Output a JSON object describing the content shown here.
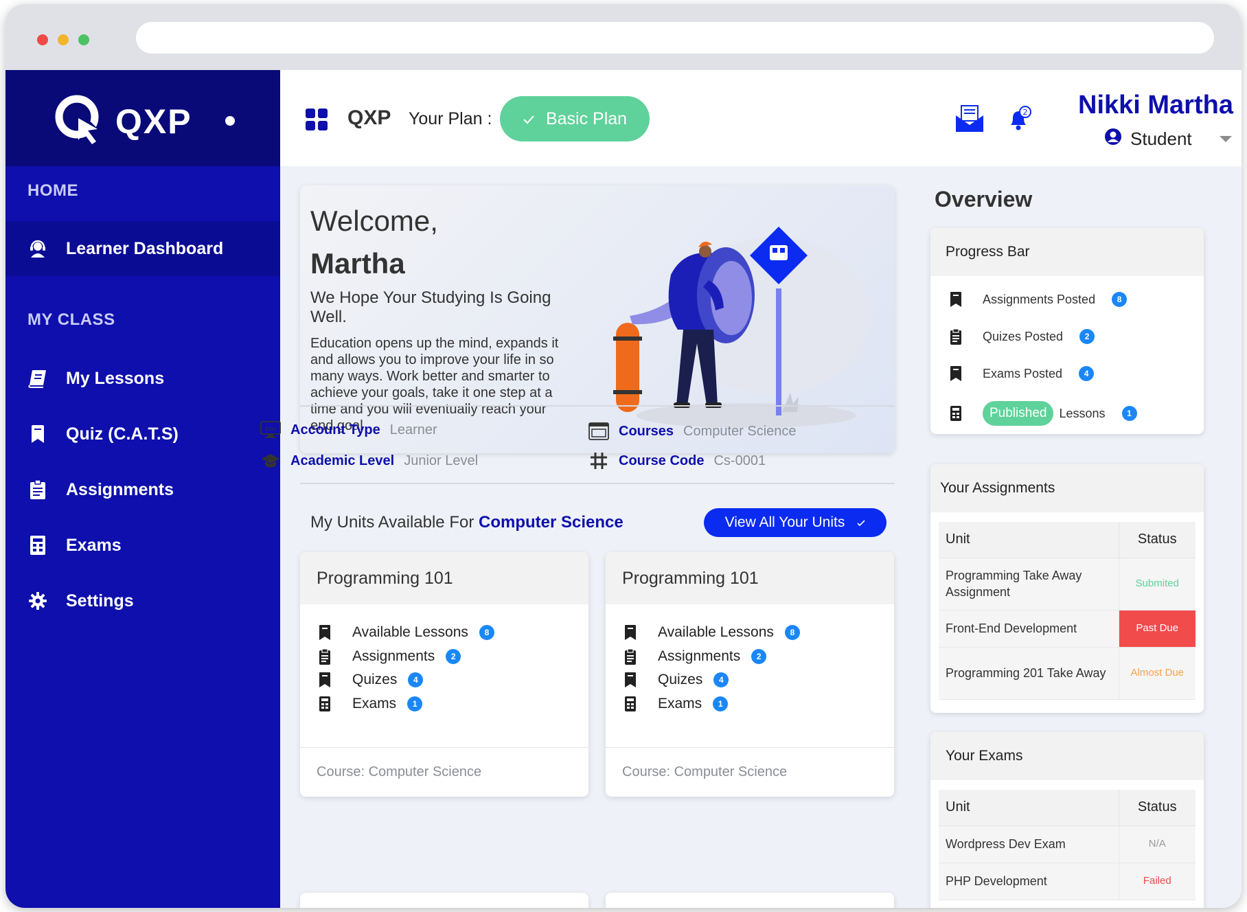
{
  "colors": {
    "sidebar": "#0e0fac",
    "sidebar_logo_bg": "#090a78",
    "accent_blue": "#0b2bf0",
    "plan_green": "#5ed29a",
    "badge_blue": "#1b87f7",
    "past_due_red": "#f24b4b",
    "almost_due_orange": "#f7a34b"
  },
  "sidebar": {
    "logo_text": "QXP",
    "section_home": "HOME",
    "section_class": "MY CLASS",
    "items": [
      {
        "label": "Learner Dashboard",
        "icon": "headset-user-icon"
      },
      {
        "label": "My Lessons",
        "icon": "book-icon"
      },
      {
        "label": "Quiz (C.A.T.S)",
        "icon": "bookmark-icon"
      },
      {
        "label": "Assignments",
        "icon": "clipboard-icon"
      },
      {
        "label": "Exams",
        "icon": "calculator-icon"
      },
      {
        "label": "Settings",
        "icon": "gear-icon"
      }
    ]
  },
  "header": {
    "brand": "QXP",
    "plan_label": "Your Plan :",
    "plan_button": "Basic Plan",
    "user_name": "Nikki Martha",
    "user_role": "Student",
    "notifications_count": "2"
  },
  "welcome": {
    "title": "Welcome,",
    "name": "Martha",
    "subtitle": "We Hope Your Studying Is Going Well.",
    "body": "Education opens up the mind, expands it and allows you to improve your life in so many ways. Work better and smarter to achieve your goals, take it one step at a time and you will eventually reach your end goal"
  },
  "account": {
    "account_type_label": "Account Type",
    "account_type_value": "Learner",
    "academic_level_label": "Academic Level",
    "academic_level_value": "Junior Level",
    "courses_label": "Courses",
    "courses_value": "Computer Science",
    "course_code_label": "Course Code",
    "course_code_value": "Cs-0001"
  },
  "units": {
    "title_prefix": "My Units Available For",
    "title_course": "Computer Science",
    "view_all_button": "View All Your Units",
    "cards": [
      {
        "title": "Programming 101",
        "rows": [
          {
            "label": "Available Lessons",
            "count": "8"
          },
          {
            "label": "Assignments",
            "count": "2"
          },
          {
            "label": "Quizes",
            "count": "4"
          },
          {
            "label": "Exams",
            "count": "1"
          }
        ],
        "footer": "Course: Computer Science"
      },
      {
        "title": "Programming 101",
        "rows": [
          {
            "label": "Available Lessons",
            "count": "8"
          },
          {
            "label": "Assignments",
            "count": "2"
          },
          {
            "label": "Quizes",
            "count": "4"
          },
          {
            "label": "Exams",
            "count": "1"
          }
        ],
        "footer": "Course: Computer Science"
      }
    ]
  },
  "overview": {
    "title": "Overview",
    "progress": {
      "title": "Progress Bar",
      "assignments_label": "Assignments Posted",
      "assignments_count": "8",
      "quizes_label": "Quizes Posted",
      "quizes_count": "2",
      "exams_label": "Exams Posted",
      "exams_count": "4",
      "published_pill": "Published",
      "lessons_label": "Lessons",
      "lessons_count": "1"
    },
    "assignments": {
      "title": "Your Assignments",
      "col_unit": "Unit",
      "col_status": "Status",
      "rows": [
        {
          "unit": "Programming Take Away Assignment",
          "status": "Submited"
        },
        {
          "unit": "Front-End Development",
          "status": "Past Due"
        },
        {
          "unit": "Programming 201 Take Away",
          "status": "Almost Due"
        }
      ]
    },
    "exams": {
      "title": "Your Exams",
      "col_unit": "Unit",
      "col_status": "Status",
      "rows": [
        {
          "unit": "Wordpress Dev Exam",
          "status": "N/A"
        },
        {
          "unit": "PHP Development",
          "status": "Failed"
        }
      ]
    }
  }
}
